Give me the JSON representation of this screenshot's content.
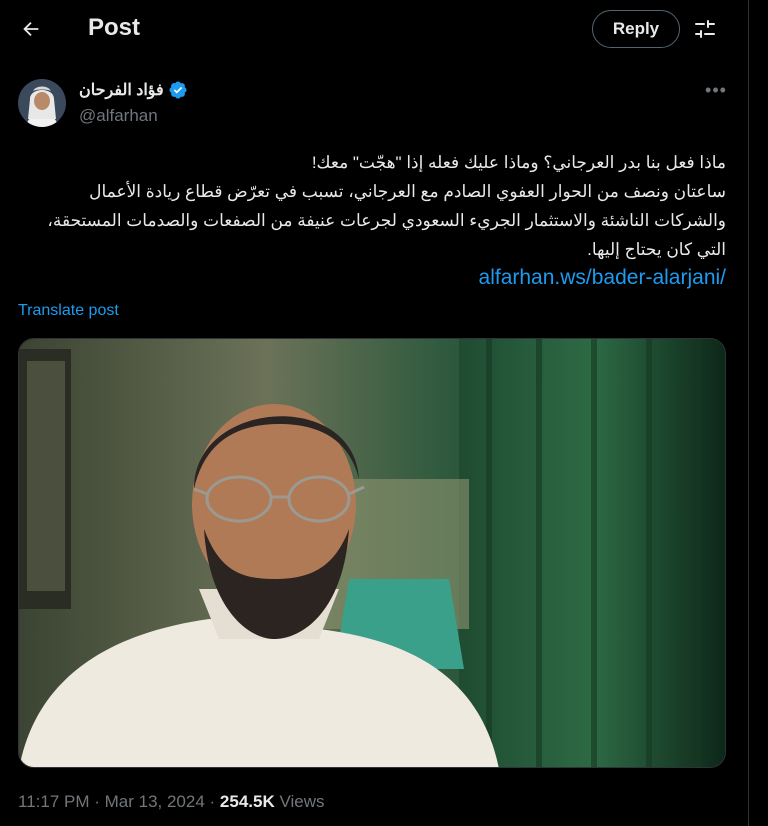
{
  "header": {
    "title": "Post",
    "reply_label": "Reply"
  },
  "author": {
    "display_name": "فؤاد الفرحان",
    "handle": "@alfarhan"
  },
  "post": {
    "line1": "ماذا فعل بنا بدر العرجاني؟ وماذا عليك فعله إذا \"هجّت\" معك!",
    "line2": "ساعتان ونصف من الحوار العفوي الصادم مع العرجاني، تسبب في تعرّض قطاع ريادة الأعمال والشركات الناشئة والاستثمار الجريء السعودي لجرعات عنيفة من الصفعات والصدمات المستحقة، التي كان يحتاج إليها.",
    "link": "alfarhan.ws/bader-alarjani/",
    "translate_label": "Translate post"
  },
  "meta": {
    "time": "11:17 PM",
    "separator1": " · ",
    "date": "Mar 13, 2024",
    "separator2": " · ",
    "views_count": "254.5K",
    "views_label": " Views"
  },
  "colors": {
    "background": "#000000",
    "text": "#e7e9ea",
    "muted": "#71767b",
    "accent": "#1d9bf0"
  },
  "icons": {
    "back": "arrow-left-icon",
    "filter": "sliders-icon",
    "verified": "verified-badge-icon",
    "more": "more-dots-icon"
  }
}
